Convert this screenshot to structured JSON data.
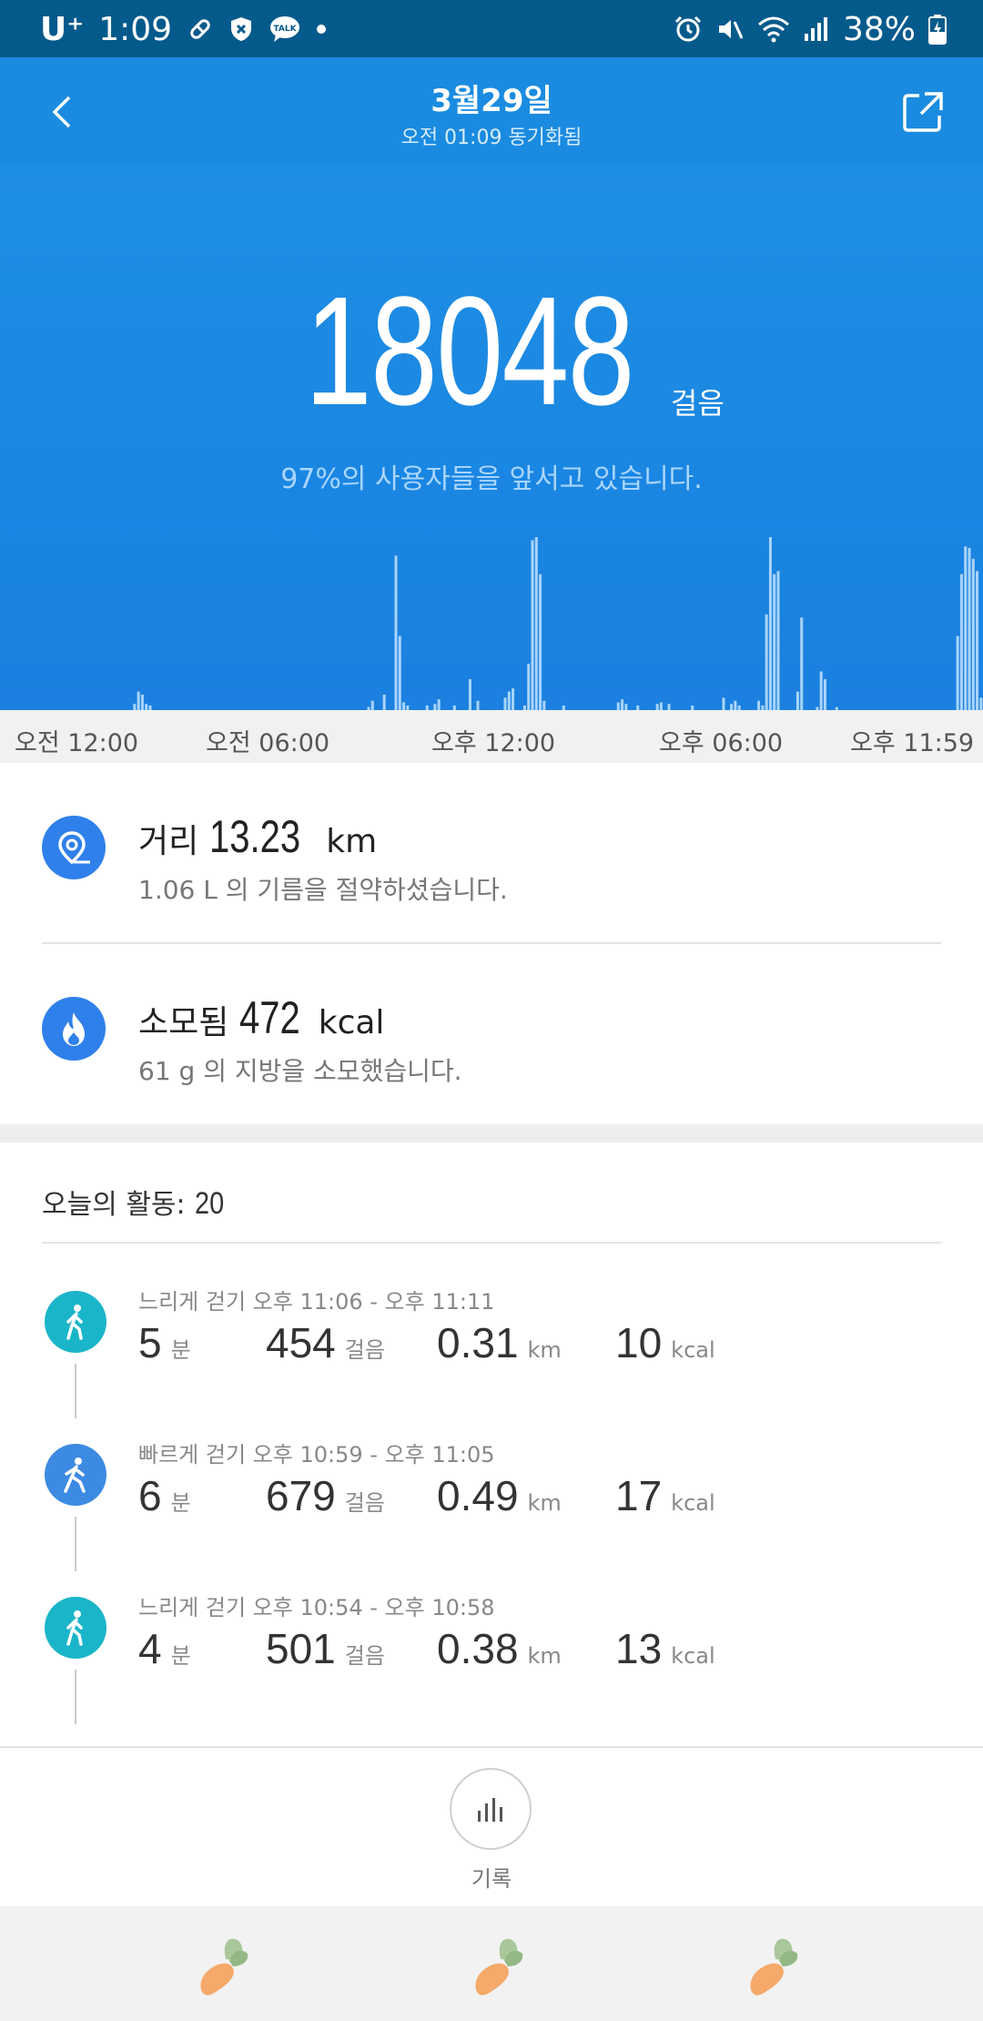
{
  "status_bar": {
    "carrier": "U⁺",
    "time": "1:09",
    "left_icons": [
      "pill-icon",
      "shield-x-icon",
      "talk-icon",
      "dot-icon"
    ],
    "talk_text": "TALK",
    "right_icons": [
      "alarm-icon",
      "mute-icon",
      "wifi-icon",
      "signal-icon",
      "battery-charging-icon"
    ],
    "battery": "38%"
  },
  "header": {
    "title": "3월29일",
    "subtitle": "오전 01:09 동기화됨"
  },
  "hero": {
    "steps": "18048",
    "steps_unit": "걸음",
    "rank_text": "97%의 사용자들을 앞서고 있습니다."
  },
  "chart_data": {
    "type": "bar",
    "description_series": "steps per time interval across the day",
    "values": [
      0,
      0,
      0,
      0,
      0,
      0,
      0,
      0,
      0,
      0,
      0,
      0,
      0,
      0,
      0,
      0,
      0,
      0,
      0,
      0,
      0,
      0,
      0,
      0,
      0,
      0,
      0,
      0,
      0,
      0,
      0,
      0,
      0,
      0,
      4,
      12,
      10,
      4,
      3,
      0,
      0,
      0,
      0,
      0,
      0,
      0,
      0,
      0,
      0,
      0,
      0,
      0,
      0,
      0,
      0,
      0,
      0,
      0,
      0,
      0,
      0,
      0,
      0,
      0,
      0,
      0,
      0,
      0,
      0,
      0,
      0,
      0,
      0,
      0,
      0,
      0,
      0,
      0,
      0,
      0,
      0,
      0,
      0,
      0,
      0,
      0,
      0,
      0,
      0,
      0,
      0,
      0,
      0,
      0,
      2,
      6,
      0,
      0,
      10,
      0,
      0,
      100,
      48,
      5,
      3,
      0,
      0,
      0,
      0,
      3,
      0,
      4,
      7,
      0,
      0,
      0,
      3,
      0,
      0,
      0,
      20,
      0,
      6,
      0,
      0,
      0,
      0,
      0,
      0,
      8,
      12,
      14,
      0,
      0,
      3,
      30,
      110,
      112,
      88,
      6,
      0,
      0,
      0,
      0,
      3,
      0,
      0,
      0,
      0,
      0,
      0,
      0,
      0,
      0,
      0,
      0,
      0,
      0,
      5,
      7,
      4,
      0,
      0,
      3,
      0,
      0,
      0,
      0,
      4,
      5,
      0,
      4,
      0,
      0,
      0,
      0,
      0,
      3,
      0,
      0,
      0,
      0,
      0,
      0,
      0,
      8,
      0,
      4,
      6,
      3,
      0,
      0,
      0,
      0,
      6,
      3,
      62,
      112,
      88,
      90,
      0,
      0,
      0,
      0,
      12,
      60,
      0,
      0,
      0,
      2,
      25,
      20,
      0,
      0,
      2,
      0,
      0,
      0,
      0,
      0,
      0,
      0,
      0,
      0,
      0,
      0,
      0,
      0,
      0,
      0,
      0,
      0,
      0,
      0,
      0,
      0,
      0,
      0,
      0,
      0,
      0,
      0,
      0,
      0,
      0,
      48,
      88,
      106,
      105,
      98,
      90,
      8
    ],
    "x_ticks": [
      "오전 12:00",
      "오전 06:00",
      "오후 12:00",
      "오후 06:00",
      "오후 11:59"
    ],
    "color": "#a9d4fb"
  },
  "metrics": [
    {
      "icon": "location-pin-icon",
      "label": "거리",
      "value": "13.23",
      "unit": "km",
      "sub": "1.06 L 의 기름을 절약하셨습니다."
    },
    {
      "icon": "flame-icon",
      "label": "소모됨",
      "value": "472",
      "unit": "kcal",
      "sub": "61 g 의 지방을 소모했습니다."
    }
  ],
  "activity": {
    "title": "오늘의 활동:",
    "count": "20",
    "items": [
      {
        "icon": "slow-walk-icon",
        "color": "#1bb5c9",
        "label": "느리게 걷기 오후 11:06 - 오후 11:11",
        "minutes": "5",
        "minutes_unit": "분",
        "steps": "454",
        "steps_unit": "걸음",
        "distance": "0.31",
        "distance_unit": "km",
        "kcal": "10",
        "kcal_unit": "kcal"
      },
      {
        "icon": "fast-walk-icon",
        "color": "#3d8ae3",
        "label": "빠르게 걷기 오후 10:59 - 오후 11:05",
        "minutes": "6",
        "minutes_unit": "분",
        "steps": "679",
        "steps_unit": "걸음",
        "distance": "0.49",
        "distance_unit": "km",
        "kcal": "17",
        "kcal_unit": "kcal"
      },
      {
        "icon": "slow-walk-icon",
        "color": "#1bb5c9",
        "label": "느리게 걷기 오후 10:54 - 오후 10:58",
        "minutes": "4",
        "minutes_unit": "분",
        "steps": "501",
        "steps_unit": "걸음",
        "distance": "0.38",
        "distance_unit": "km",
        "kcal": "13",
        "kcal_unit": "kcal"
      }
    ]
  },
  "record_button": {
    "icon": "bar-chart-icon",
    "label": "기록"
  },
  "nav": {
    "icons": [
      "carrot-icon",
      "carrot-icon",
      "carrot-icon"
    ]
  }
}
